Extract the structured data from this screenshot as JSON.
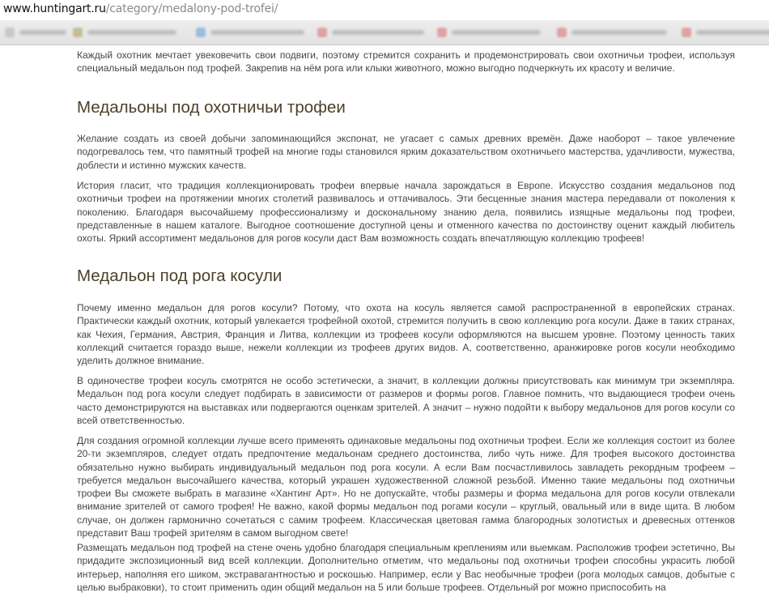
{
  "browser": {
    "url_domain": "www.huntingart.ru",
    "url_path": "/category/medalony-pod-trofei/"
  },
  "article": {
    "intro": "Каждый охотник мечтает увековечить свои подвиги, поэтому стремится сохранить и продемонстрировать свои охотничьи трофеи, используя специальный медальон под трофей. Закрепив на нём рога или клыки животного, можно выгодно подчеркнуть их красоту и величие.",
    "heading1": "Медальоны под охотничьи трофеи",
    "para1": "Желание создать из своей добычи запоминающийся экспонат, не угасает с самых древних времён. Даже наоборот – такое увлечение подогревалось тем, что памятный трофей на многие годы становился ярким доказательством охотничьего мастерства, удачливости, мужества, доблести и истинно мужских качеств.",
    "para2": "История гласит, что традиция коллекционировать трофеи впервые начала зарождаться в Европе. Искусство создания медальонов под охотничьи трофеи на протяжении многих столетий развивалось и оттачивалось. Эти бесценные знания мастера передавали от поколения к поколению. Благодаря высочайшему профессионализму и доскональному знанию дела, появились изящные медальоны под трофеи, представленные в нашем каталоге. Выгодное соотношение доступной цены и отменного качества по достоинству оценит каждый любитель охоты. Яркий ассортимент медальонов для рогов косули даст Вам возможность создать впечатляющую коллекцию трофеев!",
    "heading2": "Медальон под рога косули",
    "para3": "Почему именно медальон для рогов косули? Потому, что охота на косуль является  самой распространенной в европейских странах. Практически каждый охотник, который увлекается трофейной охотой, стремится получить в свою коллекцию рога косули. Даже в таких странах, как Чехия, Германия, Австрия, Франция и Литва, коллекции из трофеев косули оформляются на высшем уровне. Поэтому ценность таких коллекций считается гораздо выше, нежели коллекции из трофеев других видов. А, соответственно, аранжировке рогов косули необходимо уделить должное внимание.",
    "para4": "В одиночестве трофеи косуль смотрятся не особо эстетически, а значит, в коллекции должны присутствовать как минимум три экземпляра. Медальон под рога косули следует подбирать в зависимости от размеров и формы рогов. Главное помнить, что выдающиеся трофеи очень часто демонстрируются на выставках или подвергаются оценкам зрителей. А значит – нужно подойти к выбору медальонов для рогов косули со всей ответственностью.",
    "para5": "Для создания огромной коллекции лучше всего применять одинаковые медальоны под охотничьи трофеи. Если же коллекция состоит из более 20-ти экземпляров, следует  отдать предпочтение медальонам среднего достоинства, либо чуть ниже. Для трофея высокого достоинства обязательно нужно выбирать индивидуальный медальон под рога косули. А если Вам посчастливилось завладеть рекордным трофеем – требуется медальон высочайшего качества, который украшен художественной сложной резьбой. Именно такие медальоны под охотничьи трофеи Вы сможете выбрать в магазине «Хантинг Арт». Но не допускайте, чтобы размеры и форма медальона для рогов косули отвлекали внимание зрителей от самого трофея! Не важно, какой формы медальон под рогами косули – круглый, овальный или в виде щита. В любом случае, он должен гармонично сочетаться с самим трофеем. Классическая цветовая гамма благородных золотистых и древесных оттенков представит Ваш трофей зрителям в самом выгодном свете!",
    "para6": "Размещать медальон под трофей на стене очень удобно благодаря специальным креплениям или выемкам. Расположив трофеи эстетично, Вы придадите экспозиционный вид всей коллекции. Дополнительно отметим, что медальоны под охотничьи трофеи способны украсить любой интерьер, наполняя его шиком, экстравагантностью и роскошью. Например, если у Вас необычные трофеи (рога молодых самцов, добытые с целью выбраковки), то стоит применить один общий медальон на 5 или больше трофеев. Отдельный рог можно приспособить на"
  }
}
